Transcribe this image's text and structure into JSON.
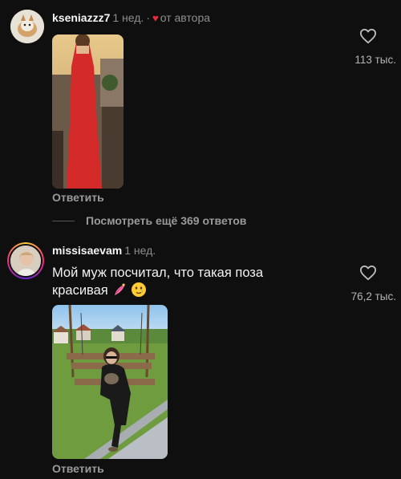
{
  "comments": [
    {
      "username": "kseniazzz7",
      "time": "1 нед.",
      "author_label": "от автора",
      "text": "",
      "likes": "113 тыс.",
      "reply_label": "Ответить"
    },
    {
      "username": "missisaevam",
      "time": "1 нед.",
      "text": "Мой муж посчитал, что такая поза красивая",
      "likes": "76,2 тыс.",
      "reply_label": "Ответить"
    }
  ],
  "view_more_label": "Посмотреть ещё 369 ответов",
  "colors": {
    "background": "#0f0f0f",
    "heart_author": "#ed2b3c",
    "muted": "#8e8e8e"
  },
  "icons": {
    "like": "heart-outline-icon",
    "author_badge": "red-heart-icon"
  }
}
